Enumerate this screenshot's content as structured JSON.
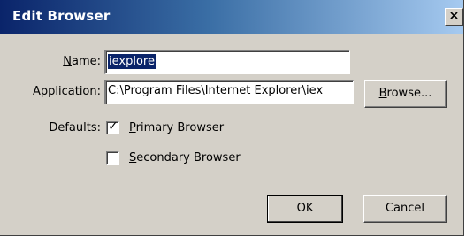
{
  "window": {
    "title": "Edit Browser",
    "close_symbol": "×"
  },
  "form": {
    "name_label": "Name:",
    "name_value": "iexplore",
    "application_label": "Application:",
    "application_value": "C:\\Program Files\\Internet Explorer\\iex",
    "browse_label": "Browse...",
    "defaults_label": "Defaults:",
    "primary_label": "Primary Browser",
    "primary_checked": true,
    "secondary_label": "Secondary Browser",
    "secondary_checked": false
  },
  "buttons": {
    "ok_label": "OK",
    "cancel_label": "Cancel"
  },
  "colors": {
    "title_bar_start": "#0a246a",
    "title_bar_end": "#a6caf0",
    "dialog_face": "#d4d0c8",
    "selection": "#0a246a"
  },
  "icons": {
    "close": "close-icon",
    "checkbox_check": "checkmark-icon"
  }
}
